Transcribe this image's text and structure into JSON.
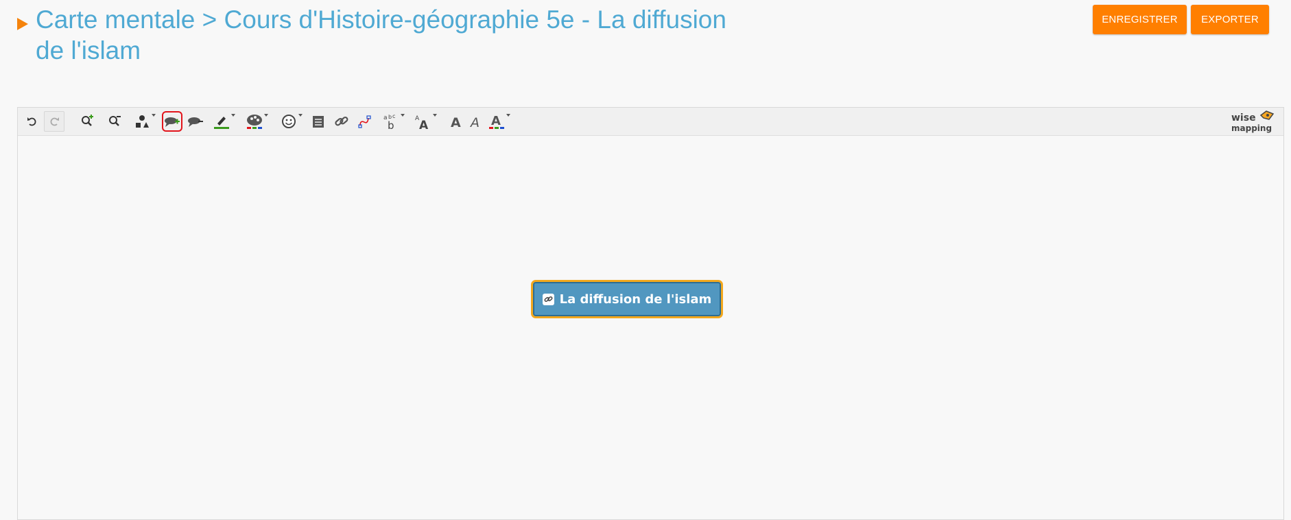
{
  "header": {
    "title": "Carte mentale > Cours d'Histoire-géographie 5e - La diffusion de l'islam",
    "save_label": "ENREGISTRER",
    "export_label": "EXPORTER"
  },
  "toolbar": {
    "tools": [
      {
        "name": "undo-icon"
      },
      {
        "name": "redo-icon",
        "state": "disabled"
      },
      {
        "name": "zoom-in-icon"
      },
      {
        "name": "zoom-out-icon"
      },
      {
        "name": "topic-shape-icon",
        "dropdown": true
      },
      {
        "name": "add-topic-icon",
        "state": "selected"
      },
      {
        "name": "delete-topic-icon"
      },
      {
        "name": "border-color-icon",
        "dropdown": true
      },
      {
        "name": "background-color-icon",
        "dropdown": true
      },
      {
        "name": "emoji-icon",
        "dropdown": true
      },
      {
        "name": "note-icon"
      },
      {
        "name": "link-icon"
      },
      {
        "name": "relationship-icon"
      },
      {
        "name": "font-family-icon",
        "dropdown": true
      },
      {
        "name": "font-size-icon",
        "dropdown": true
      },
      {
        "name": "bold-icon"
      },
      {
        "name": "italic-icon"
      },
      {
        "name": "font-color-icon",
        "dropdown": true
      }
    ],
    "logo_text": "wise mapping"
  },
  "canvas": {
    "central_topic": "La diffusion de l'islam",
    "topic_icon": "link-icon"
  },
  "colors": {
    "title": "#4fa9d3",
    "accent": "#ff7f00",
    "topic_fill": "#5197c0",
    "topic_border": "#f3a81e",
    "selection": "#e2141b"
  }
}
